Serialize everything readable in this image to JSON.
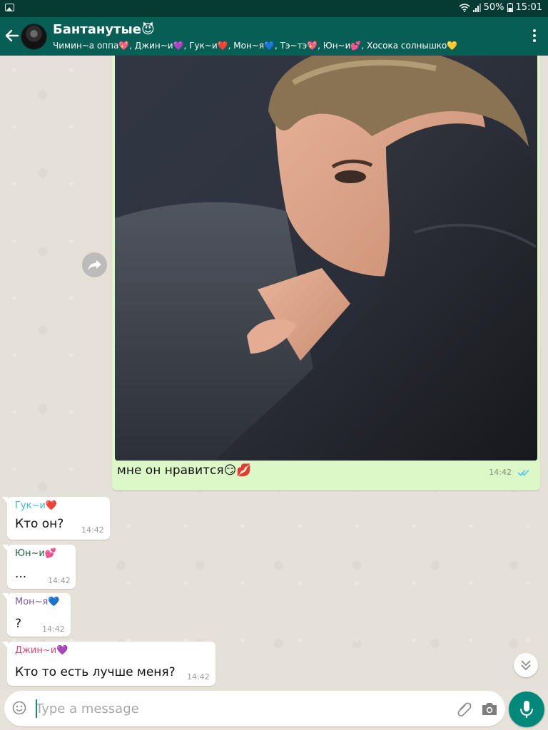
{
  "status_bar": {
    "battery": "50%",
    "time": "15:01"
  },
  "header": {
    "title": "Бантанутые😈",
    "members": "Чимин~а оппа💖, Джин~и💜, Гук~и❤️, Мон~я💙, Тэ~тэ💖, Юн~и💕, Хосока солнышко💛"
  },
  "outgoing": {
    "caption": "мне он нравится😏💋",
    "time": "14:42"
  },
  "messages": [
    {
      "sender": "Гук~и❤️",
      "sender_color": "#35c0cd",
      "text": "Кто он?",
      "time": "14:42"
    },
    {
      "sender": "Юн~и💕",
      "sender_color": "#1f5f3b",
      "text": "...",
      "time": "14:42"
    },
    {
      "sender": "Мон~я💙",
      "sender_color": "#7f5ba6",
      "text": "?",
      "time": "14:42"
    },
    {
      "sender": "Джин~и💜",
      "sender_color": "#e0447a",
      "text": "Кто то есть лучше меня?",
      "time": "14:42"
    }
  ],
  "input": {
    "placeholder": "Type a message"
  },
  "colors": {
    "header": "#075e54",
    "status_bar": "#053b33",
    "outgoing_bubble": "#dcf8c6",
    "mic_button": "#00897b",
    "read_ticks": "#4fc3f7"
  },
  "icons": [
    "gallery-icon",
    "wifi-icon",
    "signal-icon",
    "back-arrow-icon",
    "menu-dots-icon",
    "forward-icon",
    "double-check-icon",
    "chevron-down-icon",
    "emoji-icon",
    "attach-icon",
    "camera-icon",
    "mic-icon"
  ]
}
